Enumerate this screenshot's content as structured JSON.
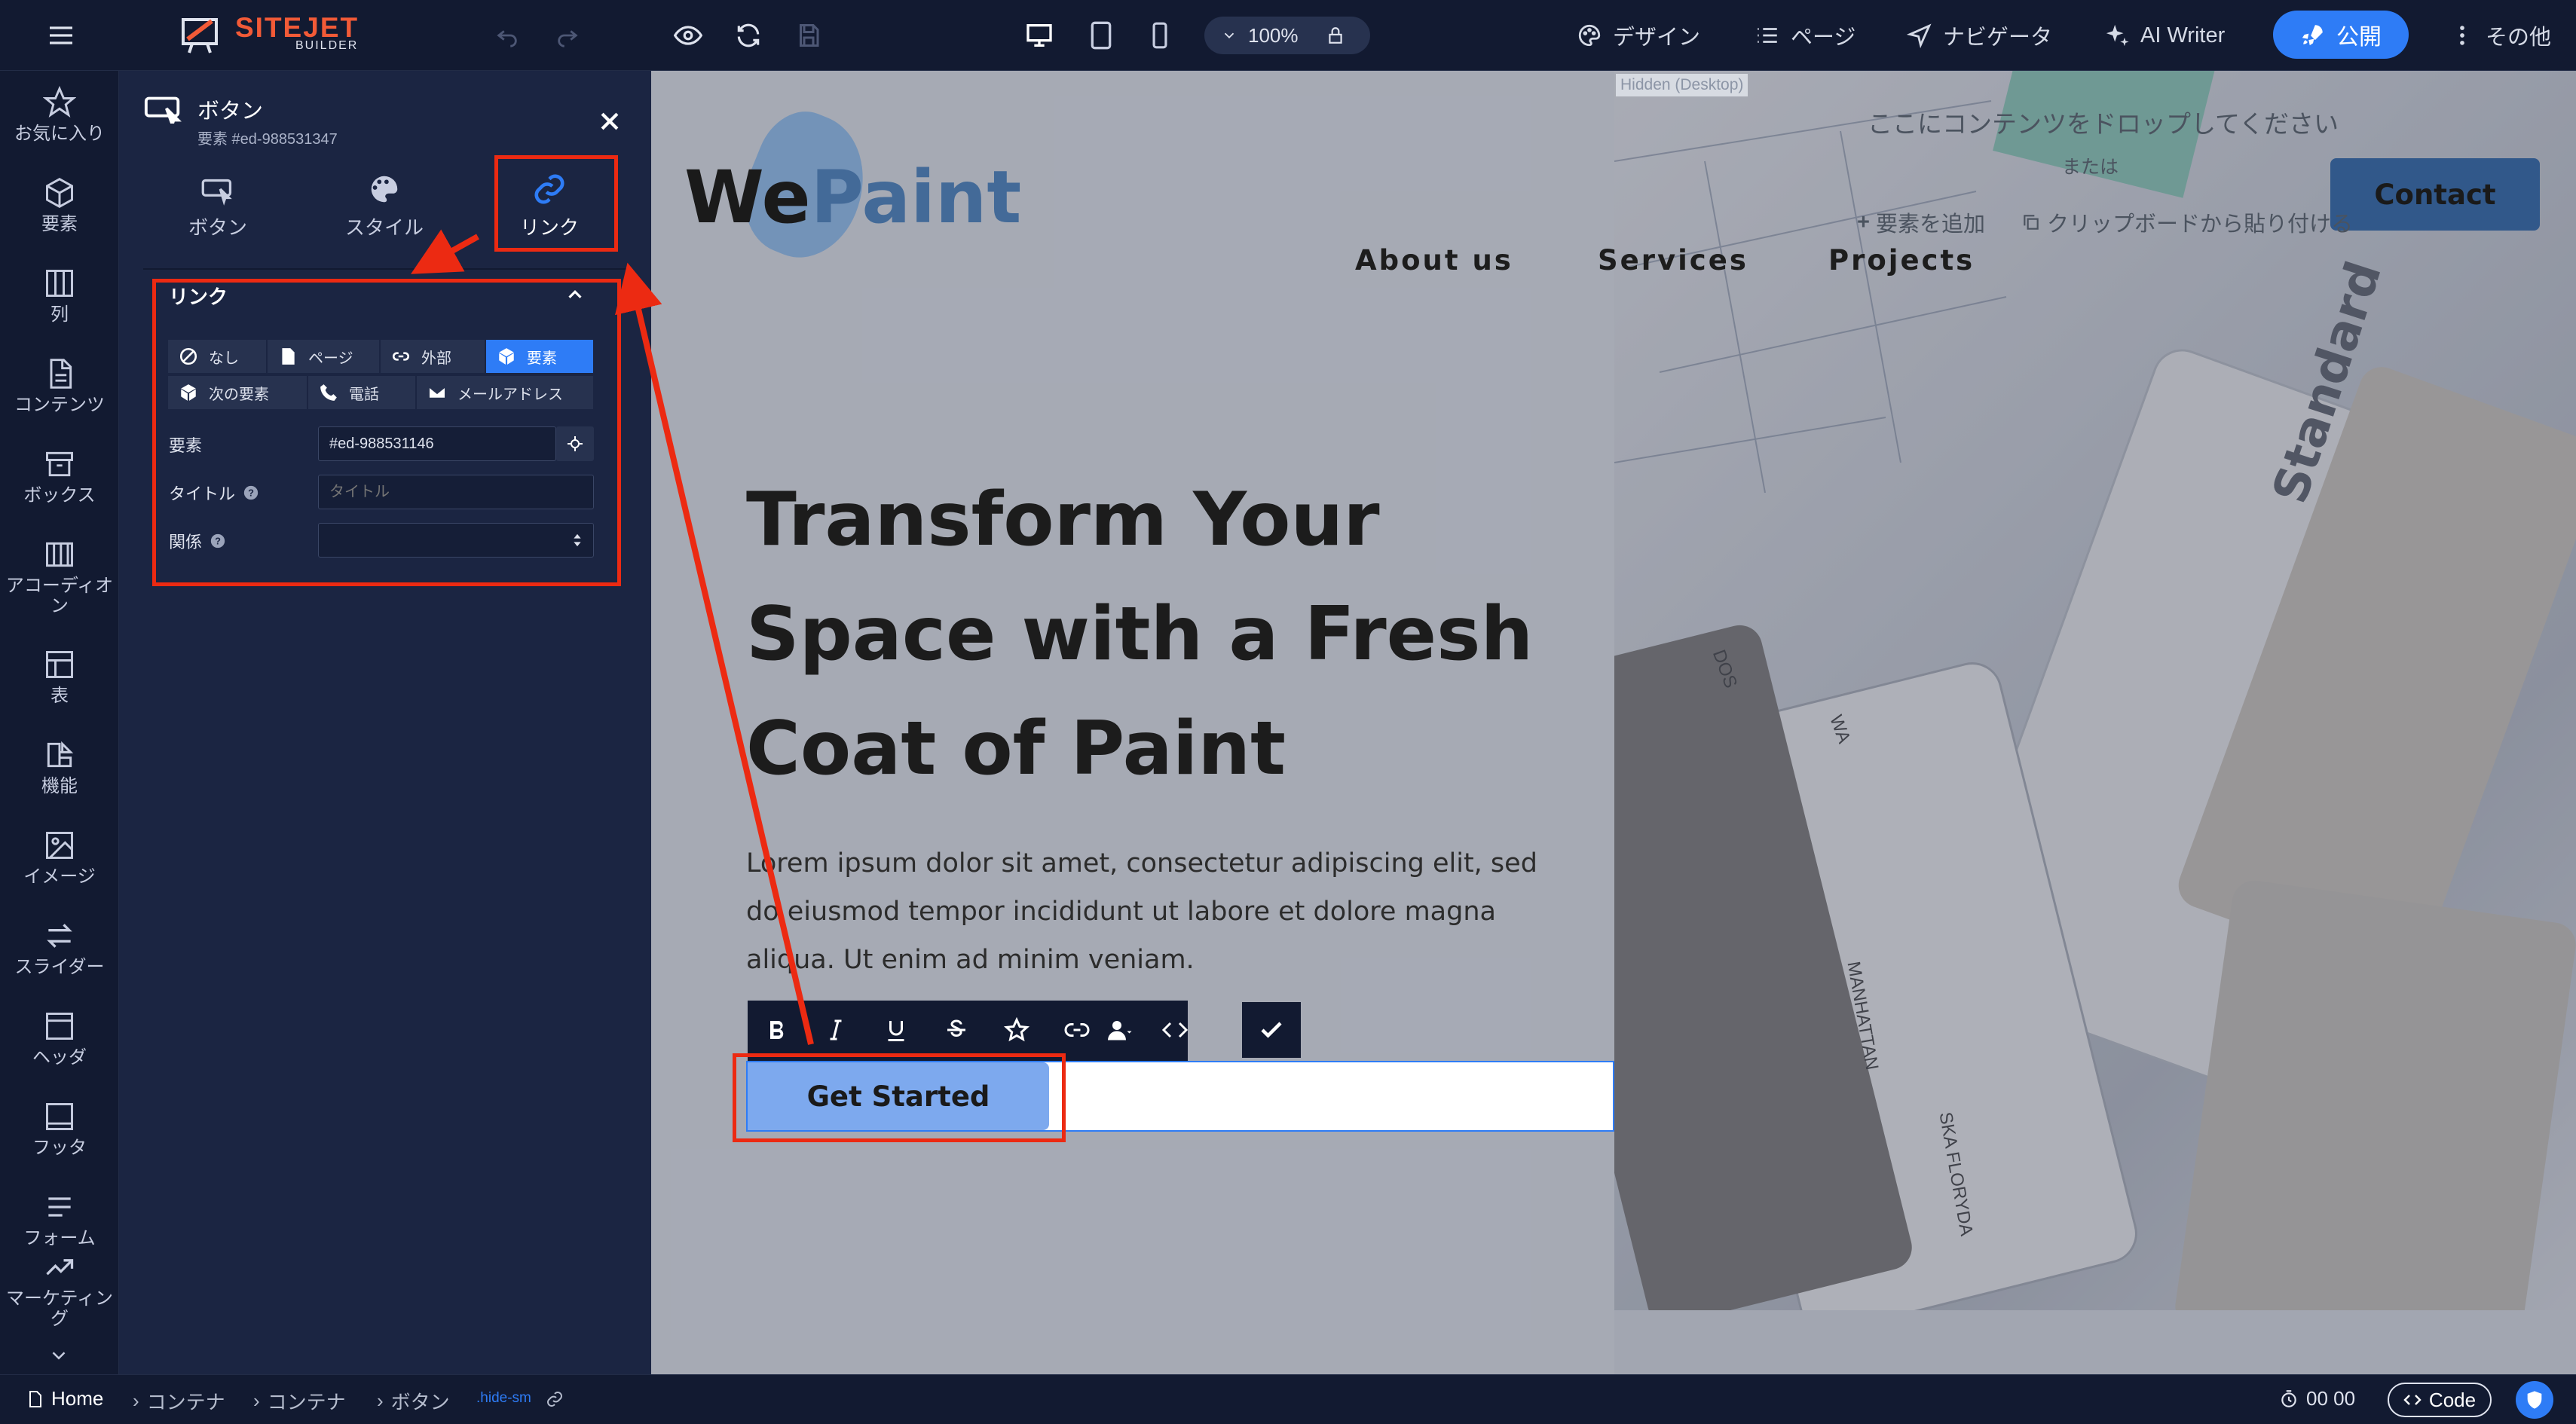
{
  "app": {
    "logo_main": "SITEJET",
    "logo_sub": "BUILDER",
    "zoom": "100%",
    "accent": "#2e7cf6"
  },
  "topbar": {
    "design": "デザイン",
    "pages": "ページ",
    "navigator": "ナビゲータ",
    "ai_writer": "AI Writer",
    "publish": "公開",
    "more": "その他"
  },
  "sidebar": {
    "items": [
      "お気に入り",
      "要素",
      "列",
      "コンテンツ",
      "ボックス",
      "アコーディオン",
      "表",
      "機能",
      "イメージ",
      "スライダー",
      "ヘッダ",
      "フッタ",
      "フォーム",
      "マーケティング"
    ]
  },
  "panel": {
    "title": "ボタン",
    "subtitle": "要素 #ed-988531347",
    "tabs": [
      "ボタン",
      "スタイル",
      "リンク"
    ],
    "section_title": "リンク",
    "link_types": [
      "なし",
      "ページ",
      "外部",
      "要素",
      "次の要素",
      "電話",
      "メールアドレス"
    ],
    "element_label": "要素",
    "element_value": "#ed-988531146",
    "title_label": "タイトル",
    "title_placeholder": "タイトル",
    "rel_label": "関係"
  },
  "canvas": {
    "logo_we": "We",
    "logo_paint": "Paint",
    "nav": [
      "About us",
      "Services",
      "Projects"
    ],
    "contact": "Contact",
    "hidden_label": "Hidden (Desktop)",
    "drop_text": "ここにコンテンツをドロップしてください",
    "or_text": "または",
    "add_element": "要素を追加",
    "paste_clipboard": "クリップボードから貼り付ける",
    "hero_title": "Transform Your Space with a Fresh Coat of Paint",
    "hero_text": "Lorem ipsum dolor sit amet, consectetur adipiscing elit, sed do eiusmod tempor incididunt ut labore et dolore magna aliqua. Ut enim ad minim veniam.",
    "cta": "Get Started",
    "swatches": [
      "Standard",
      "DOS",
      "WA",
      "MANHATTAN",
      "SKA FLORYDA"
    ]
  },
  "bottombar": {
    "breadcrumb": [
      "Home",
      "コンテナ",
      "コンテナ",
      "ボタン"
    ],
    "hide_tag": ".hide-sm",
    "timer": "00 00",
    "code": "Code"
  }
}
